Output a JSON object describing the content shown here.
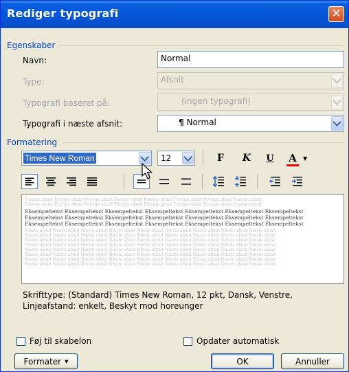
{
  "dialog": {
    "title": "Rediger typografi",
    "close_glyph": "✕"
  },
  "egenskaber": {
    "section_label": "Egenskaber",
    "navn_label": "Navn:",
    "navn_value": "Normal",
    "type_label": "Type:",
    "type_value": "Afsnit",
    "basis_label": "Typografi baseret på:",
    "basis_value": "(ingen typografi)",
    "next_label": "Typografi i næste afsnit:",
    "next_value": "Normal",
    "next_icon": "¶"
  },
  "formatering": {
    "section_label": "Formatering",
    "font_value": "Times New Roman",
    "size_value": "12",
    "bold_label": "F",
    "italic_label": "K",
    "underline_label": "U",
    "color_label": "A"
  },
  "preview": {
    "prev_text": "Forrige afsnit Forrige afsnit Forrige afsnit Forrige afsnit Forrige afsnit Forrige afsnit Forrige afsnit Forrige afsnit",
    "sample_text": "Eksempeltekst Eksempeltekst Eksempeltekst Eksempeltekst Eksempeltekst Eksempeltekst Eksempeltekst",
    "next_text": "Næste afsnit Næste afsnit Næste afsnit Næste afsnit Næste afsnit Næste afsnit Næste afsnit Næste afsnit Næste afsnit"
  },
  "description": {
    "line1": "Skrifttype: (Standard) Times New Roman, 12 pkt, Dansk, Venstre,",
    "line2": "Linjeafstand:  enkelt, Beskyt mod horeunger"
  },
  "footer": {
    "add_template_label": "Føj til skabelon",
    "auto_update_label": "Opdater automatisk",
    "format_button": "Formater",
    "ok_button": "OK",
    "cancel_button": "Annuller"
  },
  "colors": {
    "title_bar": "#0454d6",
    "section_text": "#0046d5",
    "font_color_bar": "#ff0000",
    "dialog_bg": "#ece9d8"
  }
}
